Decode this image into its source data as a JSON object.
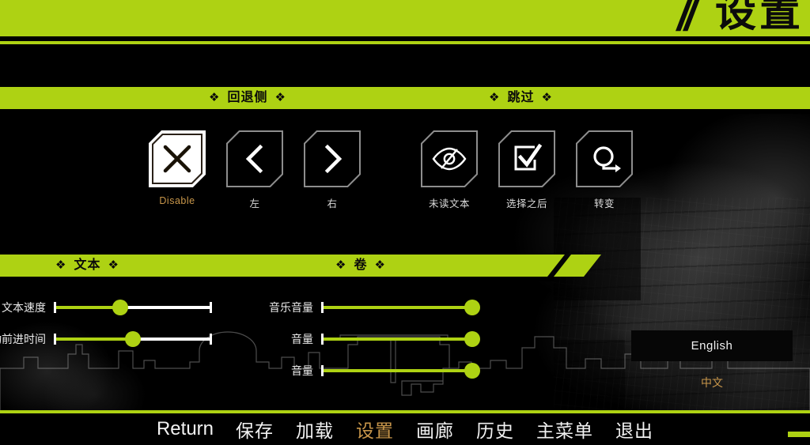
{
  "header": {
    "title": "设置",
    "slashes": "//"
  },
  "colors": {
    "accent_green": "#aed213",
    "selected_orange": "#c8964a",
    "background": "#000000",
    "text": "#f2f2f2"
  },
  "sections": [
    {
      "id": "rollback",
      "label": "回退侧",
      "diamond": "❖"
    },
    {
      "id": "skip",
      "label": "跳过",
      "diamond": "❖"
    },
    {
      "id": "text",
      "label": "文本",
      "diamond": "❖"
    },
    {
      "id": "volume",
      "label": "卷",
      "diamond": "❖"
    }
  ],
  "rollback_options": [
    {
      "label": "Disable",
      "icon": "cross-icon",
      "selected": true
    },
    {
      "label": "左",
      "icon": "chevron-left-icon",
      "selected": false
    },
    {
      "label": "右",
      "icon": "chevron-right-icon",
      "selected": false
    }
  ],
  "skip_options": [
    {
      "label": "未读文本",
      "icon": "eye-slash-icon",
      "selected": false
    },
    {
      "label": "选择之后",
      "icon": "checkbox-checked-icon",
      "selected": false
    },
    {
      "label": "转变",
      "icon": "loop-arrow-icon",
      "selected": false
    }
  ],
  "text_sliders": [
    {
      "label": "文本速度",
      "value": 42
    },
    {
      "label": "自动前进时间",
      "value": 50
    }
  ],
  "volume_sliders": [
    {
      "label": "音乐音量",
      "value": 100
    },
    {
      "label": "音量",
      "value": 100
    },
    {
      "label": "音量",
      "value": 100
    }
  ],
  "language": {
    "current": "English",
    "alternate": "中文"
  },
  "nav": [
    {
      "label": "Return",
      "active": false,
      "latin": true
    },
    {
      "label": "保存",
      "active": false,
      "latin": false
    },
    {
      "label": "加载",
      "active": false,
      "latin": false
    },
    {
      "label": "设置",
      "active": true,
      "latin": false
    },
    {
      "label": "画廊",
      "active": false,
      "latin": false
    },
    {
      "label": "历史",
      "active": false,
      "latin": false
    },
    {
      "label": "主菜单",
      "active": false,
      "latin": false
    },
    {
      "label": "退出",
      "active": false,
      "latin": false
    }
  ]
}
